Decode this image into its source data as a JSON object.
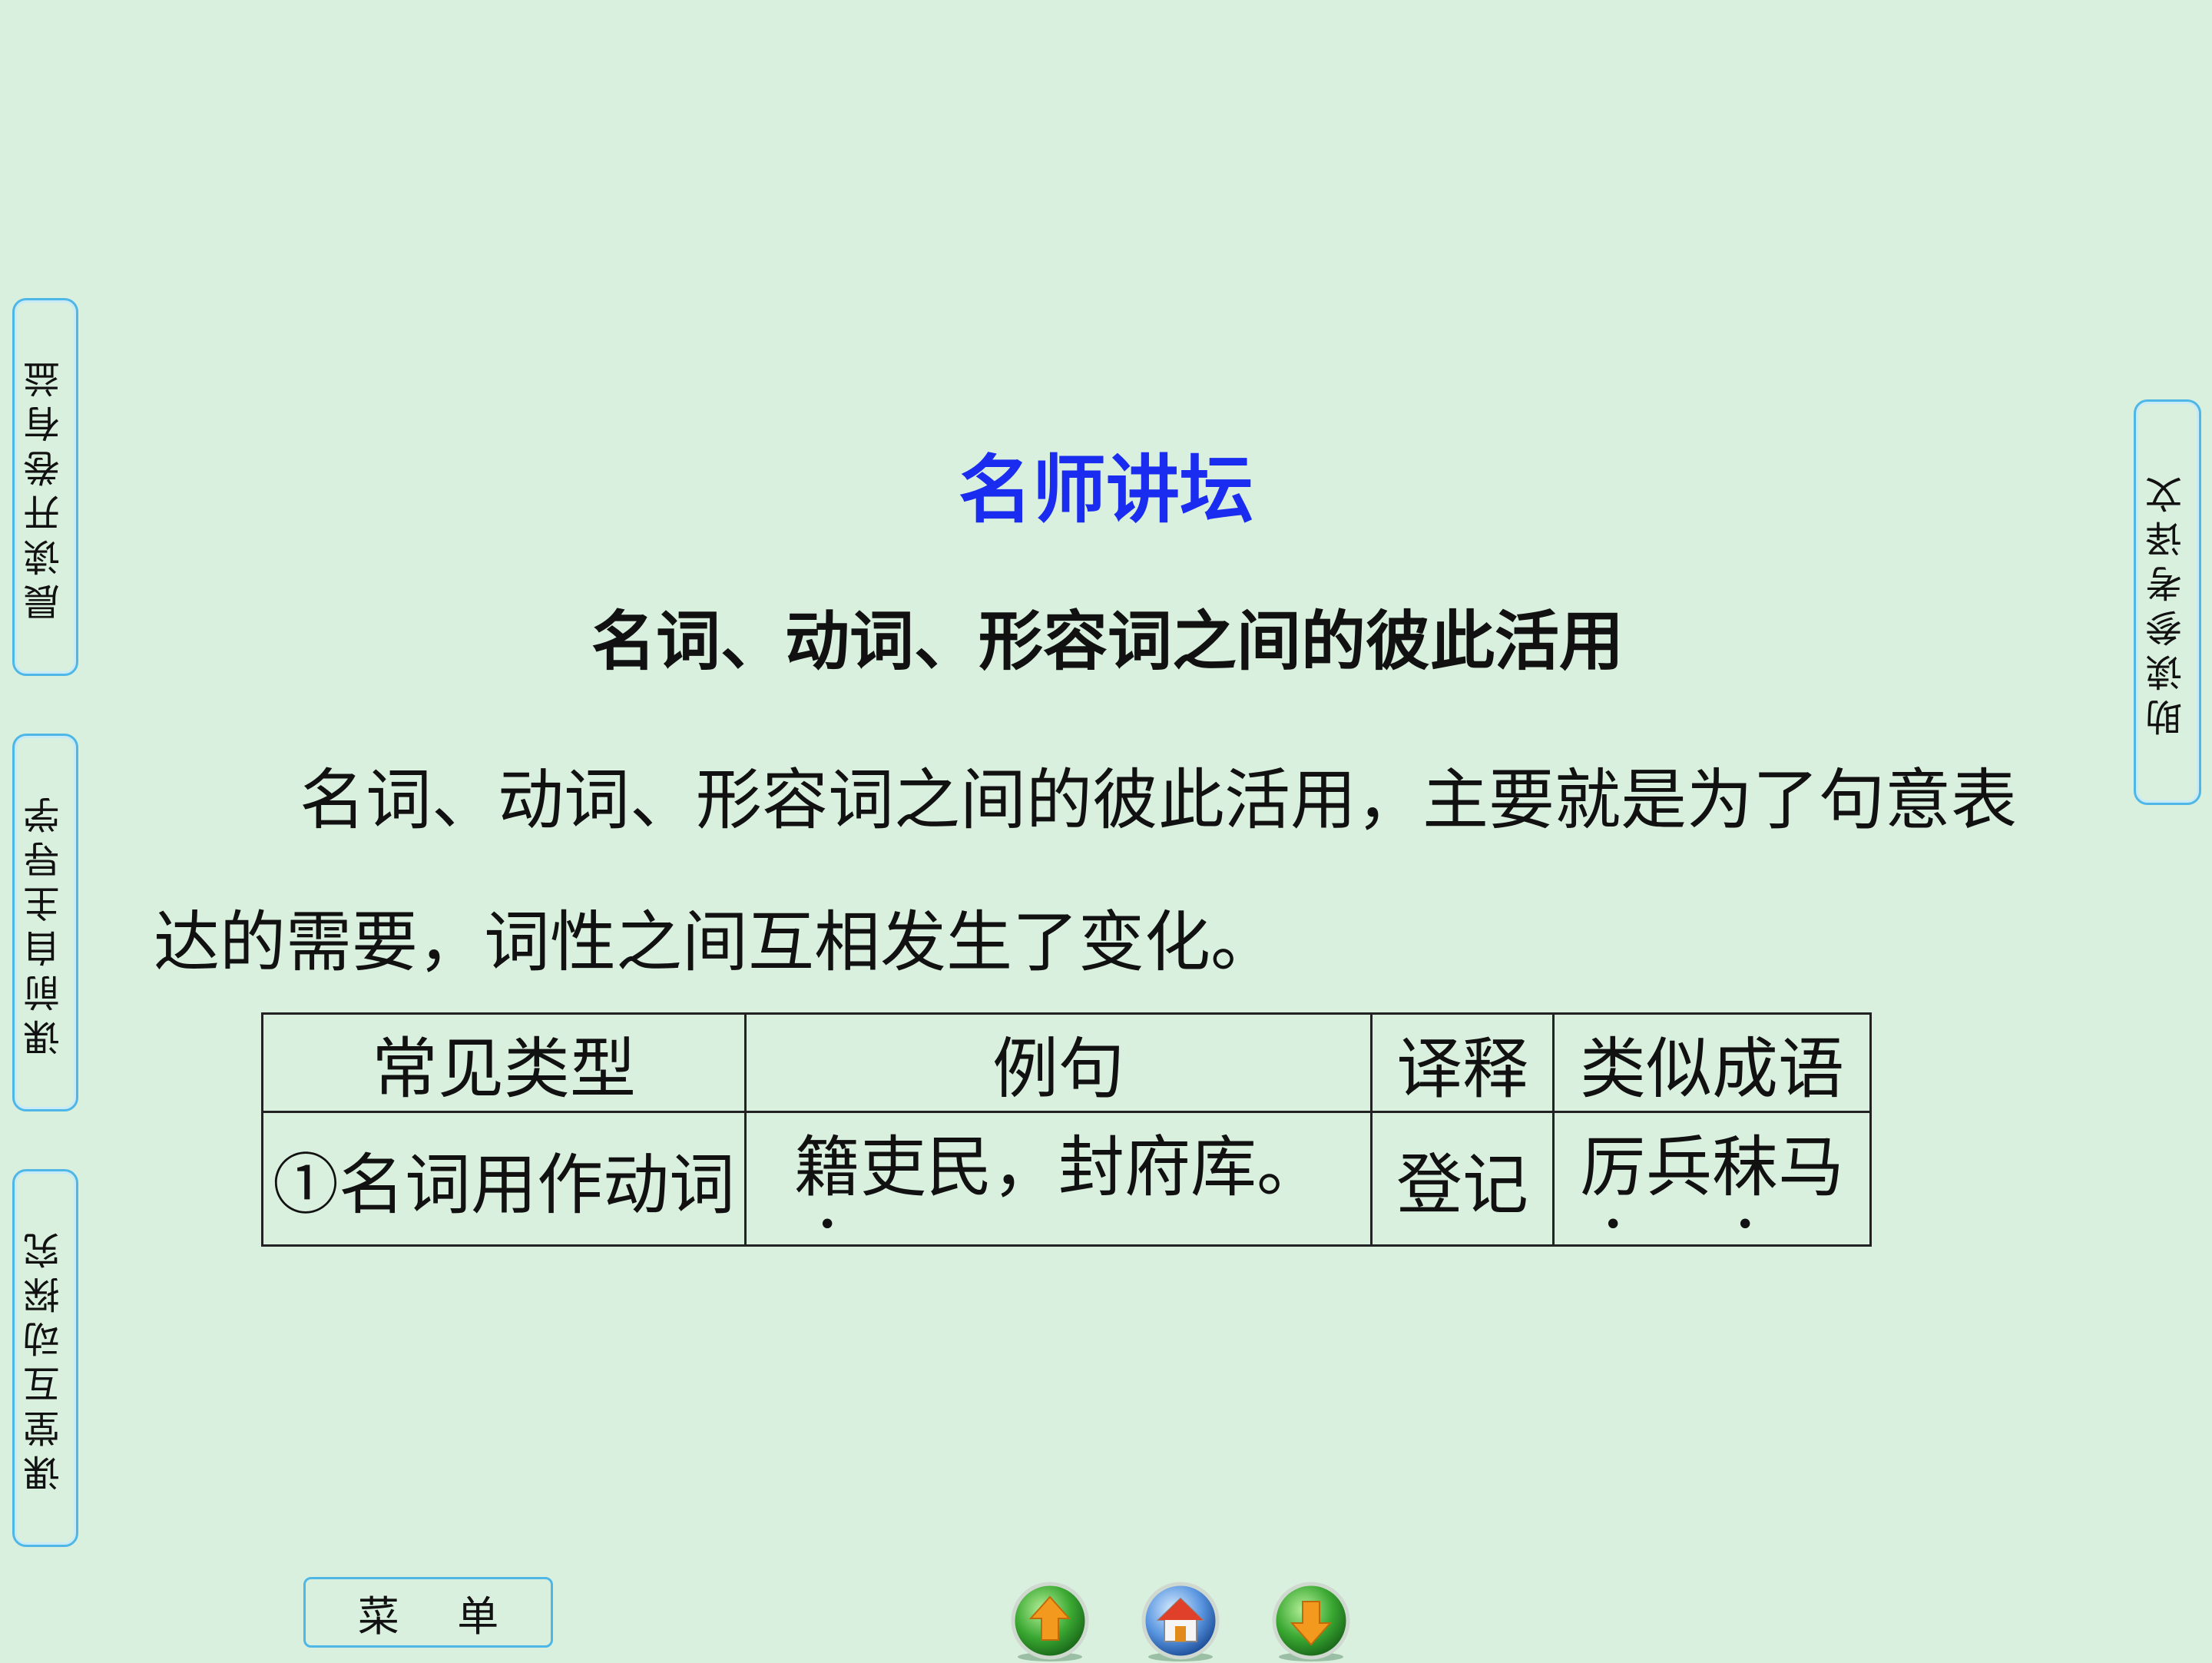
{
  "side_tabs": {
    "tab1": "晨读开卷有益",
    "tab2": "课前自主导学",
    "tab3": "课堂互动探究",
    "tab4": "助读参考译文"
  },
  "title": "名师讲坛",
  "subtitle": "名词、动词、形容词之间的彼此活用",
  "paragraph": "名词、动词、形容词之间的彼此活用，主要就是为了句意表达的需要，词性之间互相发生了变化。",
  "table": {
    "headers": [
      "常见类型",
      "例句",
      "译释",
      "类似成语"
    ],
    "rows": [
      {
        "type": "①名词用作动词",
        "example_marked": "籍",
        "example_rest": "吏民，封府库。",
        "translation": "登记",
        "idiom_parts": [
          "厉",
          "兵",
          "秣",
          "马"
        ]
      }
    ]
  },
  "menu_button": {
    "left": "菜",
    "right": "单"
  },
  "nav_icons": [
    "arrow-up-icon",
    "home-icon",
    "arrow-down-icon"
  ],
  "colors": {
    "background": "#daf0de",
    "title": "#1a2cf0",
    "tab_border": "#4fb7e6",
    "nav_orb": "#3aa832"
  }
}
